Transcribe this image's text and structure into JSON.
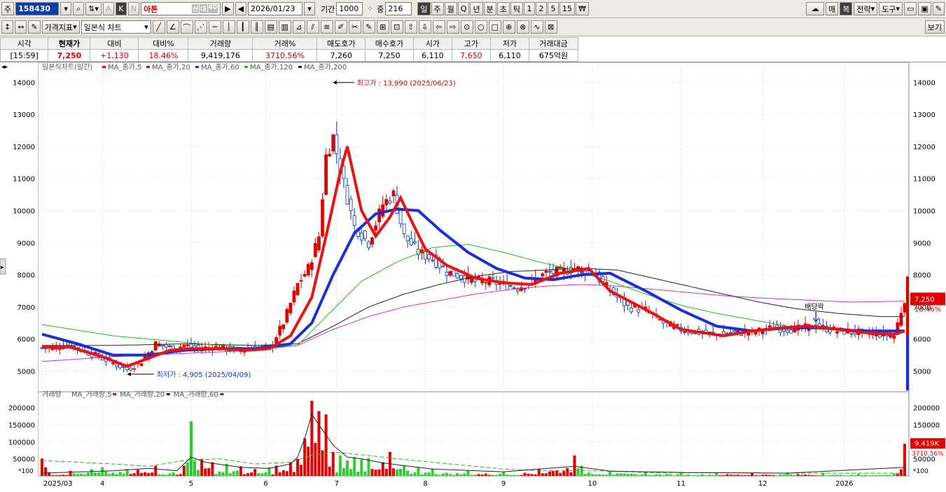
{
  "toolbar": {
    "market_label": "주",
    "stock_code": "158430",
    "stock_name": "아톤",
    "tag_new": "신",
    "tag_credit": "대",
    "tag_40": "40",
    "date": "2026/01/23",
    "period_label": "기간",
    "period_value": "1000",
    "count_label": "중",
    "count_value": "216",
    "letter_a": "A",
    "letter_k": "K",
    "letter_n": "N",
    "periods": [
      "일",
      "주",
      "월",
      "Q",
      "년",
      "분",
      "초",
      "틱",
      "1",
      "2",
      "5",
      "15",
      "₩"
    ],
    "right_buttons": [
      "매",
      "복",
      "전략",
      "도구"
    ]
  },
  "toolbar2": {
    "price_index": "가격지표",
    "chart_type": "일본식 차트",
    "view": "보기"
  },
  "quote": {
    "headers": [
      "시각",
      "현재가",
      "대비",
      "대비%",
      "거래량",
      "거래%",
      "매도호가",
      "매수호가",
      "시가",
      "고가",
      "저가",
      "거래대금"
    ],
    "values": [
      "[15:59]",
      "7,250",
      "+1,130",
      "18.46%",
      "9,419,176",
      "3710.56%",
      "7,260",
      "7,250",
      "6,110",
      "7,650",
      "6,110",
      "675억원"
    ]
  },
  "chart_data": {
    "type": "candlestick",
    "title": "일본식차트(일간)",
    "price_legend": [
      "MA_종가,5",
      "MA_종가,20",
      "MA_종가,60",
      "MA_종가,120",
      "MA_종가,200"
    ],
    "volume_title": "거래량",
    "volume_legend": [
      "MA_거래량,5",
      "MA_거래량,20",
      "MA_거래량,60"
    ],
    "ylim": [
      4400,
      14400
    ],
    "yticks": [
      5000,
      6000,
      7000,
      8000,
      9000,
      10000,
      11000,
      12000,
      13000,
      14000
    ],
    "vol_ylim": [
      0,
      230000
    ],
    "vol_yticks": [
      50000,
      100000,
      150000,
      200000
    ],
    "x_labels": [
      "2025/03",
      "4",
      "5",
      "6",
      "7",
      "8",
      "9",
      "10",
      "11",
      "12",
      "2026"
    ],
    "x_label_index": [
      0,
      17,
      42,
      63,
      83,
      108,
      130,
      155,
      180,
      203,
      226
    ],
    "n_days": 244,
    "high_label": "최고가 : 13,990 (2025/06/23)",
    "low_label": "최저가 : 4,905 (2025/04/09)",
    "dividend_label": "배당락",
    "price_box": "7,250",
    "change_box": "18.46%",
    "vol_box": "9,419K",
    "vol_pct_box": "3710.56%",
    "scale_tag": "*100",
    "closes": [
      [
        0,
        5720
      ],
      [
        8,
        5800
      ],
      [
        17,
        5400
      ],
      [
        24,
        5050
      ],
      [
        28,
        5300
      ],
      [
        32,
        5850
      ],
      [
        37,
        5700
      ],
      [
        40,
        5800
      ],
      [
        44,
        5700
      ],
      [
        48,
        5750
      ],
      [
        55,
        5650
      ],
      [
        60,
        5750
      ],
      [
        64,
        5700
      ],
      [
        68,
        6500
      ],
      [
        72,
        7700
      ],
      [
        75,
        8200
      ],
      [
        78,
        9200
      ],
      [
        80,
        11700
      ],
      [
        82,
        12300
      ],
      [
        84,
        11300
      ],
      [
        88,
        9500
      ],
      [
        92,
        9000
      ],
      [
        96,
        10200
      ],
      [
        99,
        10500
      ],
      [
        102,
        9200
      ],
      [
        106,
        8700
      ],
      [
        110,
        8500
      ],
      [
        114,
        8100
      ],
      [
        118,
        7950
      ],
      [
        122,
        7800
      ],
      [
        126,
        7800
      ],
      [
        130,
        7700
      ],
      [
        134,
        7600
      ],
      [
        138,
        7800
      ],
      [
        142,
        8050
      ],
      [
        146,
        8100
      ],
      [
        150,
        8200
      ],
      [
        155,
        8100
      ],
      [
        160,
        7500
      ],
      [
        165,
        7000
      ],
      [
        170,
        6900
      ],
      [
        175,
        6500
      ],
      [
        180,
        6300
      ],
      [
        185,
        6200
      ],
      [
        190,
        6150
      ],
      [
        196,
        6200
      ],
      [
        200,
        6200
      ],
      [
        206,
        6350
      ],
      [
        212,
        6300
      ],
      [
        218,
        6400
      ],
      [
        224,
        6250
      ],
      [
        230,
        6200
      ],
      [
        236,
        6150
      ],
      [
        240,
        6100
      ],
      [
        243,
        7250
      ]
    ],
    "ma20": [
      [
        0,
        5750
      ],
      [
        8,
        5750
      ],
      [
        17,
        5450
      ],
      [
        24,
        5150
      ],
      [
        30,
        5400
      ],
      [
        36,
        5650
      ],
      [
        42,
        5700
      ],
      [
        50,
        5700
      ],
      [
        58,
        5650
      ],
      [
        64,
        5700
      ],
      [
        70,
        6100
      ],
      [
        76,
        7300
      ],
      [
        80,
        9200
      ],
      [
        84,
        11200
      ],
      [
        86,
        12000
      ],
      [
        90,
        10000
      ],
      [
        94,
        9200
      ],
      [
        98,
        9800
      ],
      [
        101,
        10400
      ],
      [
        104,
        9700
      ],
      [
        108,
        8800
      ],
      [
        114,
        8300
      ],
      [
        122,
        7900
      ],
      [
        130,
        7750
      ],
      [
        138,
        7700
      ],
      [
        146,
        8050
      ],
      [
        154,
        8200
      ],
      [
        160,
        7500
      ],
      [
        166,
        7150
      ],
      [
        172,
        6800
      ],
      [
        180,
        6300
      ],
      [
        186,
        6200
      ],
      [
        192,
        6100
      ],
      [
        200,
        6250
      ],
      [
        208,
        6350
      ],
      [
        216,
        6400
      ],
      [
        224,
        6300
      ],
      [
        232,
        6200
      ],
      [
        240,
        6150
      ],
      [
        243,
        6250
      ]
    ],
    "ma60": [
      [
        0,
        6150
      ],
      [
        10,
        5850
      ],
      [
        20,
        5500
      ],
      [
        30,
        5500
      ],
      [
        40,
        5650
      ],
      [
        50,
        5700
      ],
      [
        60,
        5700
      ],
      [
        70,
        5850
      ],
      [
        76,
        6500
      ],
      [
        82,
        8000
      ],
      [
        88,
        9300
      ],
      [
        94,
        9900
      ],
      [
        100,
        10050
      ],
      [
        106,
        10000
      ],
      [
        112,
        9400
      ],
      [
        120,
        8700
      ],
      [
        128,
        8200
      ],
      [
        136,
        7900
      ],
      [
        144,
        7850
      ],
      [
        152,
        8000
      ],
      [
        160,
        8050
      ],
      [
        170,
        7500
      ],
      [
        180,
        6900
      ],
      [
        190,
        6400
      ],
      [
        200,
        6250
      ],
      [
        210,
        6350
      ],
      [
        220,
        6350
      ],
      [
        230,
        6250
      ],
      [
        243,
        6250
      ]
    ],
    "ma120": [
      [
        0,
        6450
      ],
      [
        20,
        6100
      ],
      [
        40,
        5900
      ],
      [
        60,
        5700
      ],
      [
        72,
        5800
      ],
      [
        80,
        6700
      ],
      [
        90,
        7800
      ],
      [
        100,
        8400
      ],
      [
        110,
        8850
      ],
      [
        120,
        8950
      ],
      [
        130,
        8700
      ],
      [
        140,
        8400
      ],
      [
        150,
        8150
      ],
      [
        160,
        7800
      ],
      [
        170,
        7400
      ],
      [
        180,
        7050
      ],
      [
        190,
        6800
      ],
      [
        200,
        6600
      ],
      [
        210,
        6400
      ],
      [
        220,
        6300
      ],
      [
        243,
        6250
      ]
    ],
    "ma200": [
      [
        0,
        5800
      ],
      [
        20,
        5800
      ],
      [
        40,
        5850
      ],
      [
        60,
        5800
      ],
      [
        72,
        5850
      ],
      [
        82,
        6400
      ],
      [
        92,
        7000
      ],
      [
        102,
        7400
      ],
      [
        112,
        7700
      ],
      [
        122,
        7950
      ],
      [
        132,
        8100
      ],
      [
        142,
        8150
      ],
      [
        152,
        8200
      ],
      [
        162,
        8150
      ],
      [
        172,
        7900
      ],
      [
        182,
        7650
      ],
      [
        192,
        7400
      ],
      [
        202,
        7150
      ],
      [
        212,
        6950
      ],
      [
        224,
        6800
      ],
      [
        236,
        6700
      ],
      [
        243,
        6700
      ]
    ],
    "ma_long": [
      [
        0,
        5300
      ],
      [
        20,
        5450
      ],
      [
        40,
        5550
      ],
      [
        60,
        5650
      ],
      [
        72,
        5800
      ],
      [
        82,
        6300
      ],
      [
        92,
        6700
      ],
      [
        102,
        7000
      ],
      [
        112,
        7200
      ],
      [
        122,
        7400
      ],
      [
        132,
        7550
      ],
      [
        142,
        7650
      ],
      [
        152,
        7700
      ],
      [
        162,
        7650
      ],
      [
        172,
        7550
      ],
      [
        182,
        7450
      ],
      [
        192,
        7350
      ],
      [
        202,
        7280
      ],
      [
        214,
        7220
      ],
      [
        228,
        7150
      ],
      [
        243,
        7180
      ]
    ],
    "volumes_peaks": [
      [
        2,
        10000
      ],
      [
        8,
        15000
      ],
      [
        14,
        20000
      ],
      [
        17,
        25000
      ],
      [
        24,
        20000
      ],
      [
        27,
        18000
      ],
      [
        32,
        30000
      ],
      [
        37,
        10000
      ],
      [
        40,
        30000
      ],
      [
        42,
        160000
      ],
      [
        45,
        50000
      ],
      [
        48,
        40000
      ],
      [
        52,
        35000
      ],
      [
        56,
        28000
      ],
      [
        60,
        20000
      ],
      [
        64,
        25000
      ],
      [
        66,
        30000
      ],
      [
        70,
        40000
      ],
      [
        72,
        50000
      ],
      [
        74,
        110000
      ],
      [
        76,
        220000
      ],
      [
        78,
        190000
      ],
      [
        80,
        180000
      ],
      [
        82,
        70000
      ],
      [
        84,
        60000
      ],
      [
        86,
        45000
      ],
      [
        88,
        55000
      ],
      [
        90,
        48000
      ],
      [
        92,
        52000
      ],
      [
        96,
        40000
      ],
      [
        98,
        70000
      ],
      [
        102,
        30000
      ],
      [
        106,
        25000
      ],
      [
        110,
        20000
      ],
      [
        120,
        15000
      ],
      [
        130,
        12000
      ],
      [
        140,
        20000
      ],
      [
        150,
        60000
      ],
      [
        152,
        30000
      ],
      [
        160,
        15000
      ],
      [
        170,
        12000
      ],
      [
        180,
        10000
      ],
      [
        190,
        10000
      ],
      [
        200,
        8000
      ],
      [
        210,
        10000
      ],
      [
        220,
        8000
      ],
      [
        230,
        6000
      ],
      [
        240,
        7000
      ],
      [
        243,
        94000
      ]
    ],
    "vol_ma20": [
      [
        0,
        45000
      ],
      [
        10,
        40000
      ],
      [
        20,
        35000
      ],
      [
        30,
        28000
      ],
      [
        40,
        45000
      ],
      [
        50,
        50000
      ],
      [
        60,
        35000
      ],
      [
        70,
        40000
      ],
      [
        76,
        60000
      ],
      [
        82,
        70000
      ],
      [
        90,
        62000
      ],
      [
        100,
        50000
      ],
      [
        110,
        40000
      ],
      [
        120,
        30000
      ],
      [
        130,
        20000
      ],
      [
        140,
        15000
      ],
      [
        150,
        16000
      ],
      [
        160,
        14000
      ],
      [
        170,
        10000
      ],
      [
        190,
        9000
      ],
      [
        210,
        8000
      ],
      [
        243,
        8000
      ]
    ],
    "vol_ma5": [
      [
        0,
        8000
      ],
      [
        20,
        15000
      ],
      [
        30,
        22000
      ],
      [
        38,
        15000
      ],
      [
        42,
        55000
      ],
      [
        46,
        40000
      ],
      [
        56,
        25000
      ],
      [
        64,
        22000
      ],
      [
        70,
        35000
      ],
      [
        72,
        55000
      ],
      [
        74,
        110000
      ],
      [
        76,
        180000
      ],
      [
        78,
        150000
      ],
      [
        82,
        90000
      ],
      [
        86,
        55000
      ],
      [
        90,
        50000
      ],
      [
        96,
        38000
      ],
      [
        102,
        30000
      ],
      [
        110,
        20000
      ],
      [
        130,
        12000
      ],
      [
        150,
        28000
      ],
      [
        160,
        14000
      ],
      [
        180,
        10000
      ],
      [
        210,
        8000
      ],
      [
        243,
        25000
      ]
    ]
  }
}
